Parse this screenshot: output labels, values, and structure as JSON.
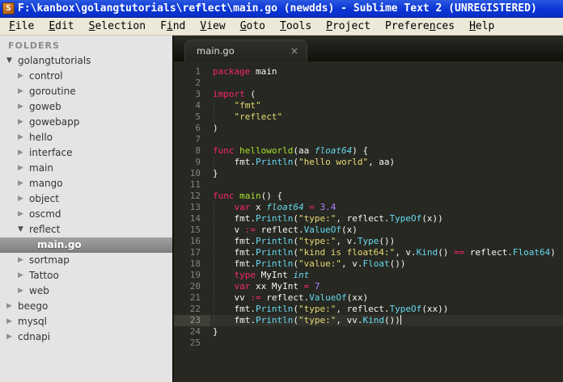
{
  "window": {
    "title": "F:\\kanbox\\golangtutorials\\reflect\\main.go (newdds) - Sublime Text 2 (UNREGISTERED)",
    "icon_letter": "S"
  },
  "menu": {
    "items": [
      {
        "id": "file",
        "pre": "",
        "key": "F",
        "post": "ile"
      },
      {
        "id": "edit",
        "pre": "",
        "key": "E",
        "post": "dit"
      },
      {
        "id": "selection",
        "pre": "",
        "key": "S",
        "post": "election"
      },
      {
        "id": "find",
        "pre": "F",
        "key": "i",
        "post": "nd"
      },
      {
        "id": "view",
        "pre": "",
        "key": "V",
        "post": "iew"
      },
      {
        "id": "goto",
        "pre": "",
        "key": "G",
        "post": "oto"
      },
      {
        "id": "tools",
        "pre": "",
        "key": "T",
        "post": "ools"
      },
      {
        "id": "project",
        "pre": "",
        "key": "P",
        "post": "roject"
      },
      {
        "id": "preferences",
        "pre": "Prefere",
        "key": "n",
        "post": "ces"
      },
      {
        "id": "help",
        "pre": "",
        "key": "H",
        "post": "elp"
      }
    ]
  },
  "sidebar": {
    "header": "FOLDERS",
    "items": [
      {
        "label": "golangtutorials",
        "level": 0,
        "arrow": "down",
        "selected": false
      },
      {
        "label": "control",
        "level": 1,
        "arrow": "right",
        "selected": false
      },
      {
        "label": "goroutine",
        "level": 1,
        "arrow": "right",
        "selected": false
      },
      {
        "label": "goweb",
        "level": 1,
        "arrow": "right",
        "selected": false
      },
      {
        "label": "gowebapp",
        "level": 1,
        "arrow": "right",
        "selected": false
      },
      {
        "label": "hello",
        "level": 1,
        "arrow": "right",
        "selected": false
      },
      {
        "label": "interface",
        "level": 1,
        "arrow": "right",
        "selected": false
      },
      {
        "label": "main",
        "level": 1,
        "arrow": "right",
        "selected": false
      },
      {
        "label": "mango",
        "level": 1,
        "arrow": "right",
        "selected": false
      },
      {
        "label": "object",
        "level": 1,
        "arrow": "right",
        "selected": false
      },
      {
        "label": "oscmd",
        "level": 1,
        "arrow": "right",
        "selected": false
      },
      {
        "label": "reflect",
        "level": 1,
        "arrow": "down",
        "selected": false
      },
      {
        "label": "main.go",
        "level": 2,
        "arrow": "none",
        "selected": true
      },
      {
        "label": "sortmap",
        "level": 1,
        "arrow": "right",
        "selected": false
      },
      {
        "label": "Tattoo",
        "level": 1,
        "arrow": "right",
        "selected": false
      },
      {
        "label": "web",
        "level": 1,
        "arrow": "right",
        "selected": false
      },
      {
        "label": "beego",
        "level": 0,
        "arrow": "right",
        "selected": false
      },
      {
        "label": "mysql",
        "level": 0,
        "arrow": "right",
        "selected": false
      },
      {
        "label": "cdnapi",
        "level": 0,
        "arrow": "right",
        "selected": false
      }
    ]
  },
  "editor": {
    "tab": {
      "label": "main.go",
      "close_glyph": "×"
    },
    "lines": [
      {
        "num": 1,
        "tokens": [
          [
            "k",
            "package"
          ],
          [
            "p",
            " main"
          ]
        ]
      },
      {
        "num": 2,
        "tokens": []
      },
      {
        "num": 3,
        "tokens": [
          [
            "k",
            "import"
          ],
          [
            "p",
            " ("
          ]
        ]
      },
      {
        "num": 4,
        "tokens": [
          [
            "p",
            "    "
          ],
          [
            "s",
            "\"fmt\""
          ]
        ]
      },
      {
        "num": 5,
        "tokens": [
          [
            "p",
            "    "
          ],
          [
            "s",
            "\"reflect\""
          ]
        ]
      },
      {
        "num": 6,
        "tokens": [
          [
            "p",
            ")"
          ]
        ]
      },
      {
        "num": 7,
        "tokens": []
      },
      {
        "num": 8,
        "tokens": [
          [
            "k",
            "func"
          ],
          [
            "p",
            " "
          ],
          [
            "f",
            "helloworld"
          ],
          [
            "p",
            "(aa "
          ],
          [
            "t",
            "float64"
          ],
          [
            "p",
            ") {"
          ]
        ]
      },
      {
        "num": 9,
        "tokens": [
          [
            "p",
            "    fmt."
          ],
          [
            "c",
            "Println"
          ],
          [
            "p",
            "("
          ],
          [
            "s",
            "\"hello world\""
          ],
          [
            "p",
            ", aa)"
          ]
        ]
      },
      {
        "num": 10,
        "tokens": [
          [
            "p",
            "}"
          ]
        ]
      },
      {
        "num": 11,
        "tokens": []
      },
      {
        "num": 12,
        "tokens": [
          [
            "k",
            "func"
          ],
          [
            "p",
            " "
          ],
          [
            "f",
            "main"
          ],
          [
            "p",
            "() {"
          ]
        ]
      },
      {
        "num": 13,
        "tokens": [
          [
            "p",
            "    "
          ],
          [
            "k",
            "var"
          ],
          [
            "p",
            " x "
          ],
          [
            "t",
            "float64"
          ],
          [
            "p",
            " "
          ],
          [
            "k",
            "="
          ],
          [
            "p",
            " "
          ],
          [
            "n",
            "3.4"
          ]
        ]
      },
      {
        "num": 14,
        "tokens": [
          [
            "p",
            "    fmt."
          ],
          [
            "c",
            "Println"
          ],
          [
            "p",
            "("
          ],
          [
            "s",
            "\"type:\""
          ],
          [
            "p",
            ", reflect."
          ],
          [
            "c",
            "TypeOf"
          ],
          [
            "p",
            "(x))"
          ]
        ]
      },
      {
        "num": 15,
        "tokens": [
          [
            "p",
            "    v "
          ],
          [
            "k",
            ":="
          ],
          [
            "p",
            " reflect."
          ],
          [
            "c",
            "ValueOf"
          ],
          [
            "p",
            "(x)"
          ]
        ]
      },
      {
        "num": 16,
        "tokens": [
          [
            "p",
            "    fmt."
          ],
          [
            "c",
            "Println"
          ],
          [
            "p",
            "("
          ],
          [
            "s",
            "\"type:\""
          ],
          [
            "p",
            ", v."
          ],
          [
            "c",
            "Type"
          ],
          [
            "p",
            "())"
          ]
        ]
      },
      {
        "num": 17,
        "tokens": [
          [
            "p",
            "    fmt."
          ],
          [
            "c",
            "Println"
          ],
          [
            "p",
            "("
          ],
          [
            "s",
            "\"kind is float64:\""
          ],
          [
            "p",
            ", v."
          ],
          [
            "c",
            "Kind"
          ],
          [
            "p",
            "() "
          ],
          [
            "k",
            "=="
          ],
          [
            "p",
            " reflect."
          ],
          [
            "c",
            "Float64"
          ],
          [
            "p",
            ")"
          ]
        ]
      },
      {
        "num": 18,
        "tokens": [
          [
            "p",
            "    fmt."
          ],
          [
            "c",
            "Println"
          ],
          [
            "p",
            "("
          ],
          [
            "s",
            "\"value:\""
          ],
          [
            "p",
            ", v."
          ],
          [
            "c",
            "Float"
          ],
          [
            "p",
            "())"
          ]
        ]
      },
      {
        "num": 19,
        "tokens": [
          [
            "p",
            "    "
          ],
          [
            "k",
            "type"
          ],
          [
            "p",
            " MyInt "
          ],
          [
            "t",
            "int"
          ]
        ]
      },
      {
        "num": 20,
        "tokens": [
          [
            "p",
            "    "
          ],
          [
            "k",
            "var"
          ],
          [
            "p",
            " xx MyInt "
          ],
          [
            "k",
            "="
          ],
          [
            "p",
            " "
          ],
          [
            "n",
            "7"
          ]
        ]
      },
      {
        "num": 21,
        "tokens": [
          [
            "p",
            "    vv "
          ],
          [
            "k",
            ":="
          ],
          [
            "p",
            " reflect."
          ],
          [
            "c",
            "ValueOf"
          ],
          [
            "p",
            "(xx)"
          ]
        ]
      },
      {
        "num": 22,
        "tokens": [
          [
            "p",
            "    fmt."
          ],
          [
            "c",
            "Println"
          ],
          [
            "p",
            "("
          ],
          [
            "s",
            "\"type:\""
          ],
          [
            "p",
            ", reflect."
          ],
          [
            "c",
            "TypeOf"
          ],
          [
            "p",
            "(xx))"
          ]
        ]
      },
      {
        "num": 23,
        "tokens": [
          [
            "p",
            "    fmt."
          ],
          [
            "c",
            "Println"
          ],
          [
            "p",
            "("
          ],
          [
            "s",
            "\"type:\""
          ],
          [
            "p",
            ", vv."
          ],
          [
            "c",
            "Kind"
          ],
          [
            "p",
            "())"
          ]
        ],
        "current": true,
        "cursor": true
      },
      {
        "num": 24,
        "tokens": [
          [
            "p",
            "}"
          ]
        ]
      },
      {
        "num": 25,
        "tokens": []
      }
    ]
  },
  "colors": {
    "titlebar_blue": "#0b35d6",
    "menubar_bg": "#ece9d8",
    "sidebar_bg": "#e4e4e4",
    "sidebar_selected": "#8d8d8d",
    "editor_bg": "#272822",
    "keyword_pink": "#f92672",
    "string_yellow": "#e6db74",
    "type_cyan": "#66d9ef",
    "func_green": "#a6e22e",
    "number_purple": "#ae81ff",
    "plain_text": "#f8f8f2",
    "line_number_gray": "#83847d"
  }
}
